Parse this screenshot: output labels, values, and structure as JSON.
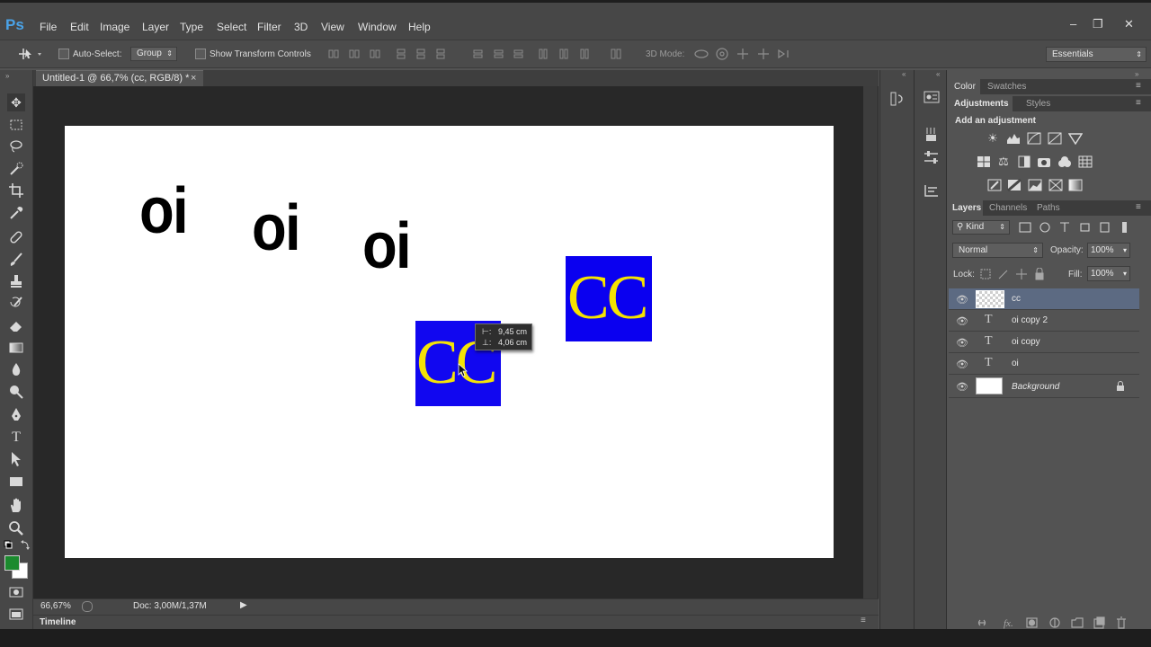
{
  "app": {
    "logo": "Ps"
  },
  "menu": [
    "File",
    "Edit",
    "Image",
    "Layer",
    "Type",
    "Select",
    "Filter",
    "3D",
    "View",
    "Window",
    "Help"
  ],
  "window_controls": {
    "minimize": "–",
    "restore": "❐",
    "close": "✕"
  },
  "options_bar": {
    "auto_select_label": "Auto-Select:",
    "auto_select_value": "Group",
    "transform_label": "Show Transform Controls",
    "mode_3d_label": "3D Mode:",
    "workspace": "Essentials"
  },
  "document": {
    "tab_title": "Untitled-1 @ 66,7% (cc, RGB/8) *",
    "tab_close": "×",
    "texts": [
      "oi",
      "oi",
      "oi"
    ],
    "cc_text": "CC",
    "measure": {
      "dx": "9,45 cm",
      "dy": "4,06 cm"
    },
    "colors": {
      "cc_bg": "#0a00f0",
      "cc_fg": "#f5e300",
      "fg_swatch": "#1b8a2e",
      "bg_swatch": "#ffffff"
    }
  },
  "status": {
    "zoom": "66,67%",
    "doc": "Doc: 3,00M/1,37M"
  },
  "timeline": {
    "label": "Timeline"
  },
  "panels": {
    "color_tabs": [
      "Color",
      "Swatches"
    ],
    "adj_tabs": [
      "Adjustments",
      "Styles"
    ],
    "add_adjustment": "Add an adjustment",
    "layers_tabs": [
      "Layers",
      "Channels",
      "Paths"
    ],
    "kind": "Kind",
    "blend_mode": "Normal",
    "opacity_label": "Opacity:",
    "opacity": "100%",
    "lock_label": "Lock:",
    "fill_label": "Fill:",
    "fill": "100%",
    "layers": [
      {
        "name": "cc",
        "type": "smart",
        "selected": true
      },
      {
        "name": "oi copy 2",
        "type": "text"
      },
      {
        "name": "oi copy",
        "type": "text"
      },
      {
        "name": "oi",
        "type": "text"
      },
      {
        "name": "Background",
        "type": "background",
        "locked": true
      }
    ]
  }
}
